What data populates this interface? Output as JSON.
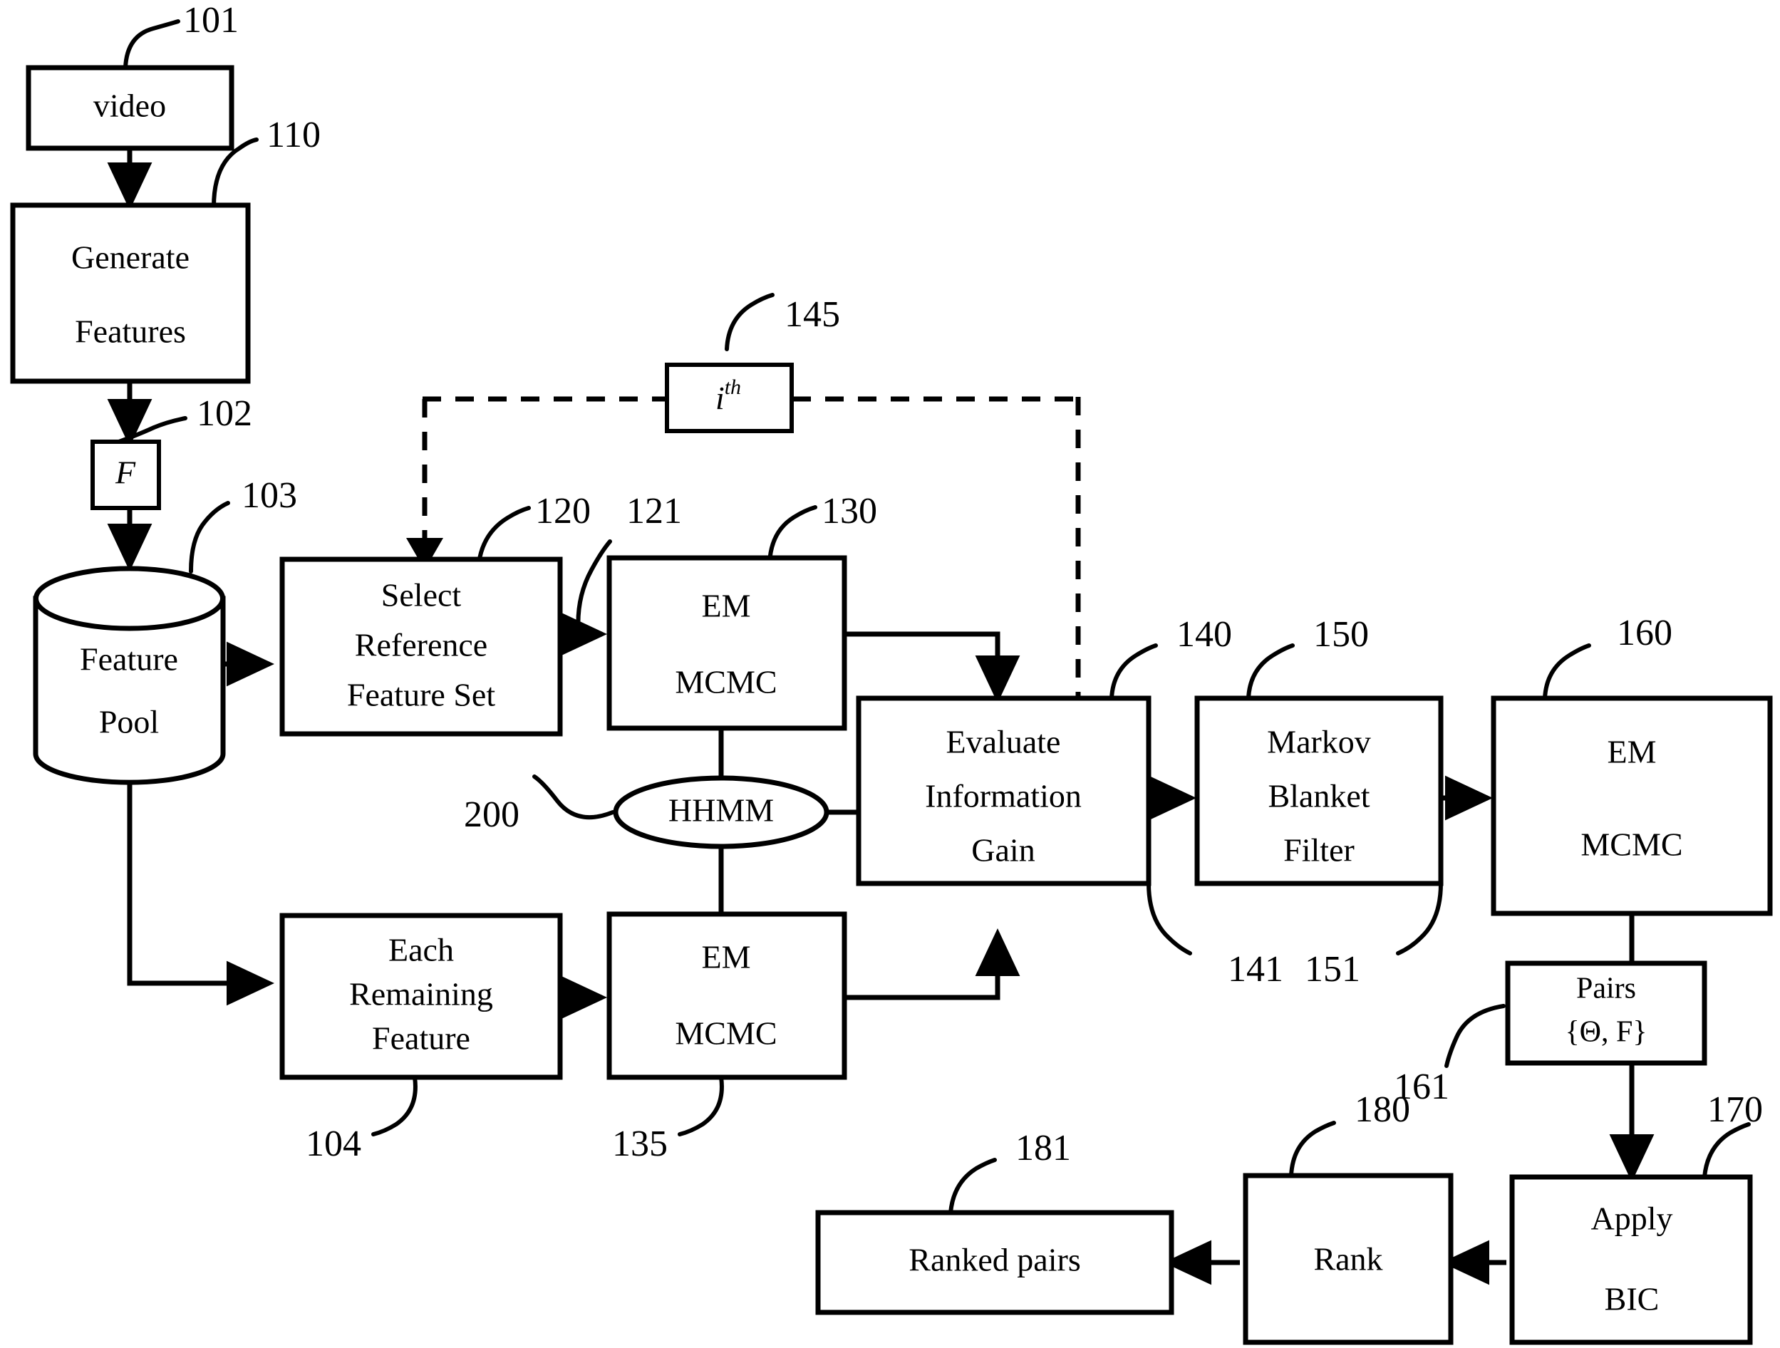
{
  "figure": {
    "kind": "patent-flowchart",
    "background_color": "#ffffff",
    "line_color": "#000000"
  },
  "nodes": {
    "video": {
      "label": "video",
      "ref": "101"
    },
    "generate_features": {
      "line1": "Generate",
      "line2": "Features",
      "ref": "110"
    },
    "f_symbol": {
      "label": "F",
      "ref": "102"
    },
    "feature_pool": {
      "line1": "Feature",
      "line2": "Pool",
      "ref": "103"
    },
    "select_reference": {
      "line1": "Select",
      "line2": "Reference",
      "line3": "Feature Set",
      "ref": "120"
    },
    "em_mcmc_top": {
      "line1": "EM",
      "line2": "MCMC",
      "ref": "130",
      "in_ref": "121"
    },
    "ith": {
      "label_i": "i",
      "label_sup": "th",
      "ref": "145"
    },
    "hhmm": {
      "label": "HHMM",
      "ref": "200"
    },
    "each_remaining": {
      "line1": "Each",
      "line2": "Remaining",
      "line3": "Feature",
      "ref": "104"
    },
    "em_mcmc_bottom": {
      "line1": "EM",
      "line2": "MCMC",
      "ref": "135"
    },
    "evaluate_info_gain": {
      "line1": "Evaluate",
      "line2": "Information",
      "line3": "Gain",
      "ref": "140",
      "out_ref": "141"
    },
    "markov_blanket": {
      "line1": "Markov",
      "line2": "Blanket",
      "line3": "Filter",
      "ref": "150",
      "out_ref": "151"
    },
    "em_mcmc_right": {
      "line1": "EM",
      "line2": "MCMC",
      "ref": "160"
    },
    "pairs": {
      "line1": "Pairs",
      "line2": "{Θ, F}",
      "ref": "161"
    },
    "apply_bic": {
      "line1": "Apply",
      "line2": "BIC",
      "ref": "170"
    },
    "rank": {
      "label": "Rank",
      "ref": "180"
    },
    "ranked_pairs": {
      "label": "Ranked pairs",
      "ref": "181"
    }
  },
  "reference_numerals": [
    "101",
    "110",
    "102",
    "103",
    "120",
    "121",
    "130",
    "145",
    "140",
    "150",
    "160",
    "200",
    "104",
    "135",
    "141",
    "151",
    "161",
    "170",
    "180",
    "181"
  ]
}
